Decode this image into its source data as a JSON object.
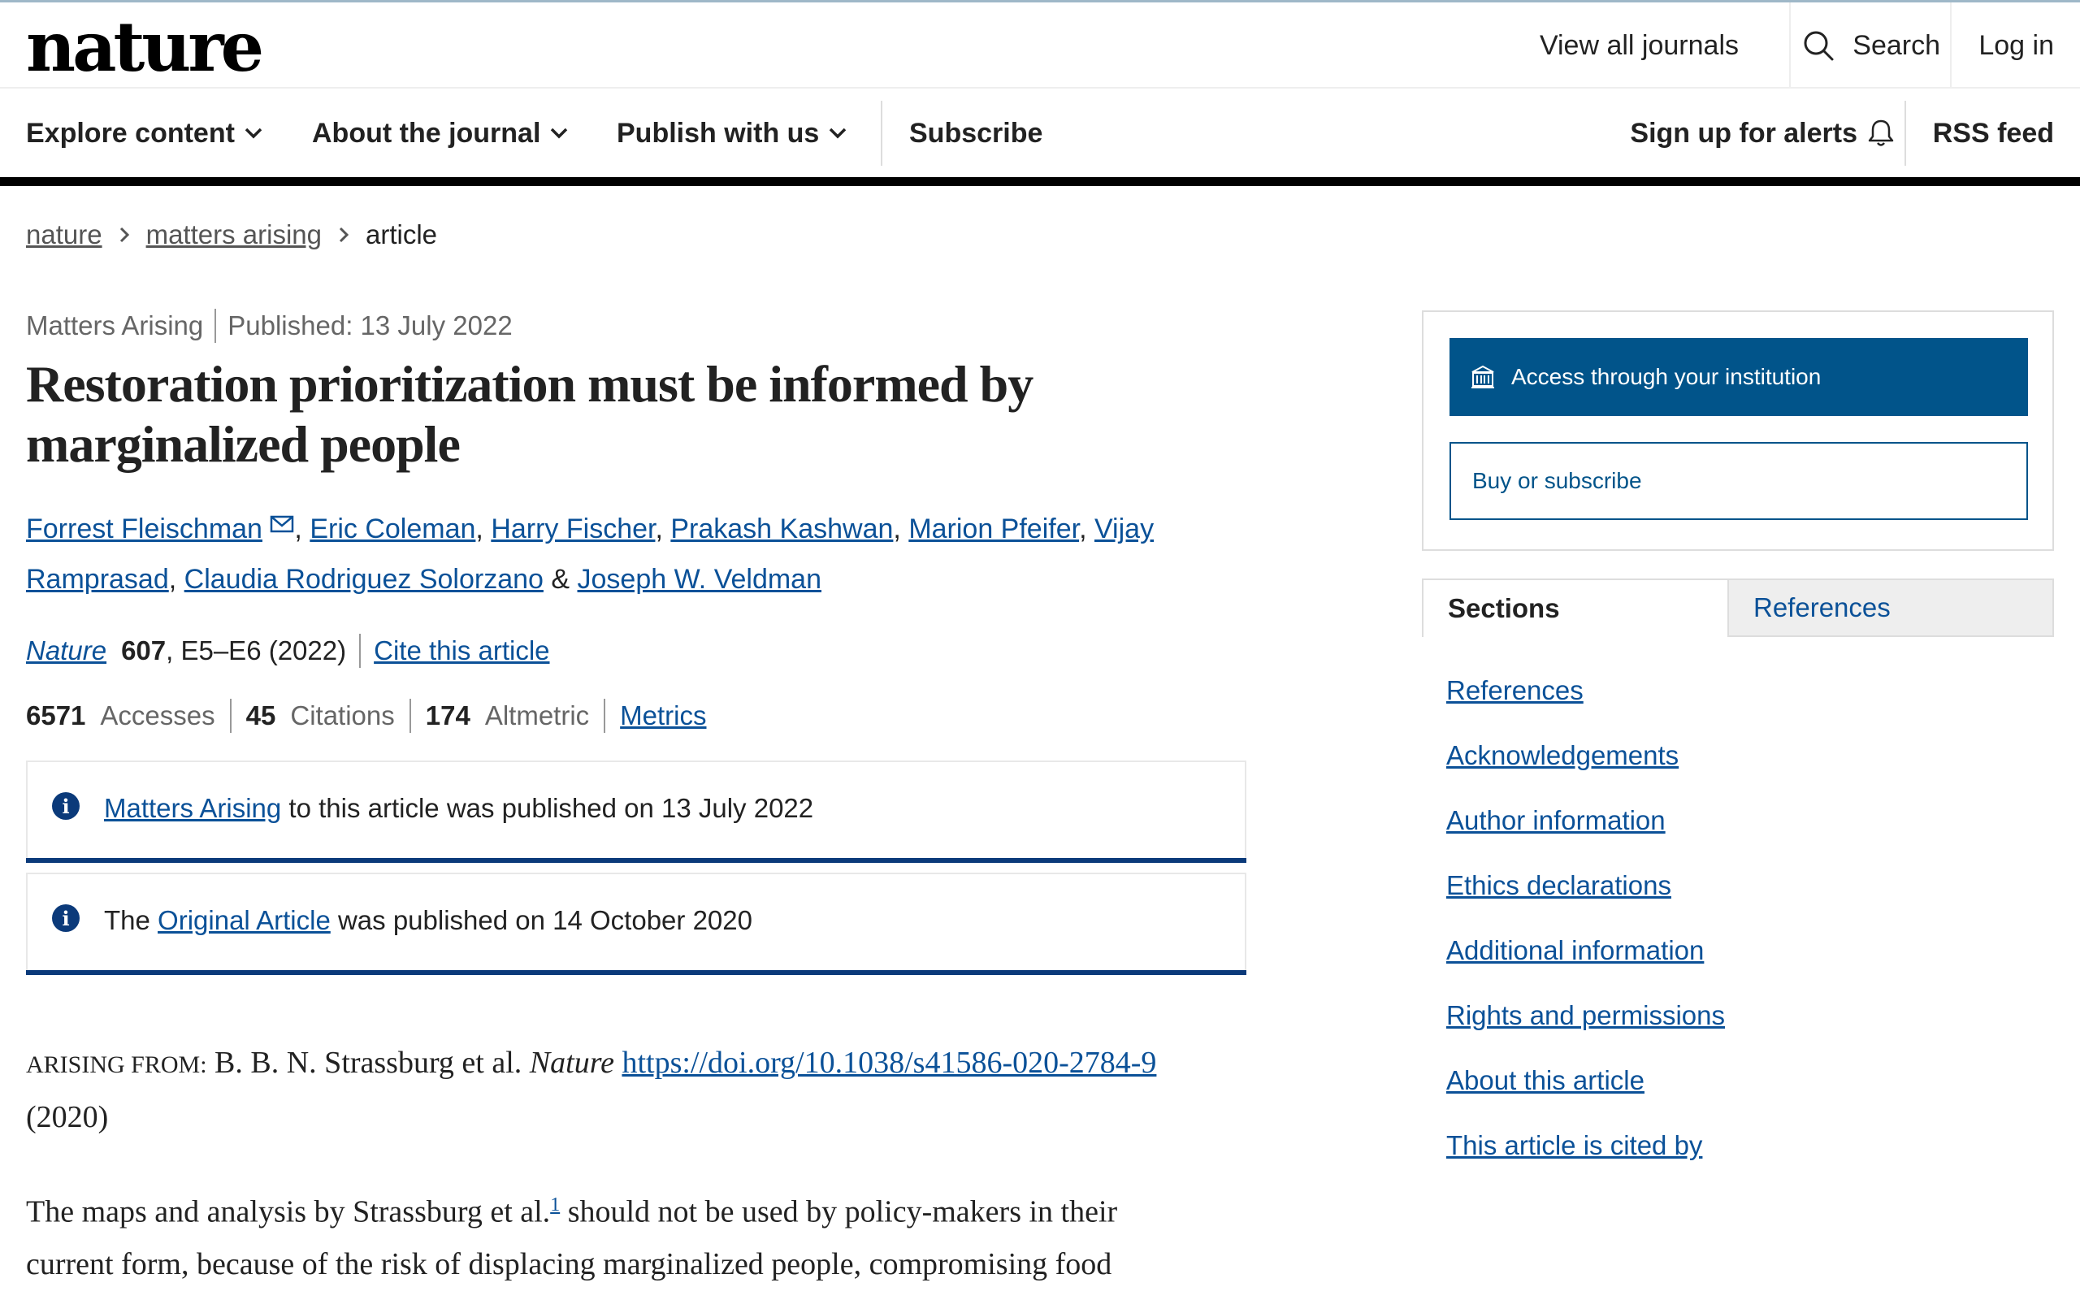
{
  "header": {
    "logo": "nature",
    "view_all": "View all journals",
    "search": "Search",
    "login": "Log in"
  },
  "nav": {
    "explore": "Explore content",
    "about": "About the journal",
    "publish": "Publish with us",
    "subscribe": "Subscribe",
    "alerts": "Sign up for alerts",
    "rss": "RSS feed"
  },
  "breadcrumb": {
    "items": [
      "nature",
      "matters arising"
    ],
    "current": "article"
  },
  "article": {
    "type": "Matters Arising",
    "published": "Published: 13 July 2022",
    "title": "Restoration prioritization must be informed by marginalized people",
    "authors": [
      "Forrest Fleischman",
      "Eric Coleman",
      "Harry Fischer",
      "Prakash Kashwan",
      "Marion Pfeifer",
      "Vijay Ramprasad",
      "Claudia Rodriguez Solorzano",
      "Joseph W. Veldman"
    ],
    "journal": "Nature",
    "volume": "607",
    "pages": ", E5–E6 (2022)",
    "cite": "Cite this article"
  },
  "metrics": {
    "accesses_num": "6571",
    "accesses_lbl": "Accesses",
    "citations_num": "45",
    "citations_lbl": "Citations",
    "altmetric_num": "174",
    "altmetric_lbl": "Altmetric",
    "link": "Metrics"
  },
  "notices": [
    {
      "prefix": "",
      "link": "Matters Arising",
      "suffix": " to this article was published on 13 July 2022"
    },
    {
      "prefix": "The ",
      "link": "Original Article",
      "suffix": " was published on 14 October 2020"
    }
  ],
  "arising": {
    "label": "ARISING FROM:",
    "authors": " B. B. N. Strassburg et al. ",
    "journal": "Nature",
    "doi": "https://doi.org/10.1038/s41586-020-2784-9",
    "year": "(2020)"
  },
  "body": {
    "line1_a": "The maps and analysis by Strassburg et al.",
    "ref": "1",
    "line1_b": " should not be used by policy-makers in their",
    "line2": "current form, because of the risk of displacing marginalized people, compromising food"
  },
  "access": {
    "institution": "Access through your institution",
    "buy": "Buy or subscribe"
  },
  "tabs": {
    "sections": "Sections",
    "references": "References"
  },
  "sections": [
    "References",
    "Acknowledgements",
    "Author information",
    "Ethics declarations",
    "Additional information",
    "Rights and permissions",
    "About this article",
    "This article is cited by"
  ],
  "colors": {
    "link": "#0b5198",
    "access_button": "#01548a",
    "notice_rule": "#0b3a7a"
  }
}
